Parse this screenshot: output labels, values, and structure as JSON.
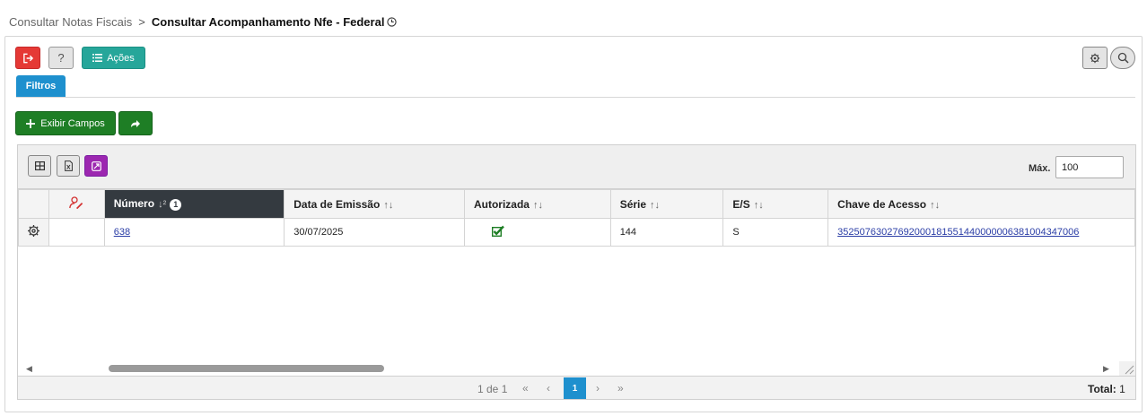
{
  "breadcrumb": {
    "parent": "Consultar Notas Fiscais",
    "separator": ">",
    "current": "Consultar Acompanhamento Nfe - Federal"
  },
  "toolbar": {
    "help_label": "?",
    "acoes_label": "Ações",
    "exit_icon": "exit-icon",
    "settings_icon": "gear-icon",
    "search_icon": "search-icon"
  },
  "tabs": {
    "filtros_label": "Filtros"
  },
  "actions": {
    "exibir_label": "Exibir Campos",
    "share_icon": "share-icon"
  },
  "grid": {
    "max_label": "Máx.",
    "max_value": "100",
    "columns": [
      {
        "label": "Número",
        "sorted": true,
        "sort_order": "1"
      },
      {
        "label": "Data de Emissão"
      },
      {
        "label": "Autorizada"
      },
      {
        "label": "Série"
      },
      {
        "label": "E/S"
      },
      {
        "label": "Chave de Acesso"
      }
    ],
    "rows": [
      {
        "numero": "638",
        "data_emissao": "30/07/2025",
        "autorizada": true,
        "serie": "144",
        "es": "S",
        "chave": "35250763027692000181551440000006381004347006"
      }
    ]
  },
  "pagination": {
    "info": "1 de 1",
    "first": "«",
    "prev": "‹",
    "current": "1",
    "next": "›",
    "last": "»",
    "total_label": "Total:",
    "total_value": "1"
  },
  "colors": {
    "exit": "#e53935",
    "acoes": "#26a69a",
    "filtros": "#1e90ce",
    "green": "#1e7e25",
    "purple": "#9c27b0",
    "header_active": "#343a40",
    "link": "#2a3da6"
  }
}
